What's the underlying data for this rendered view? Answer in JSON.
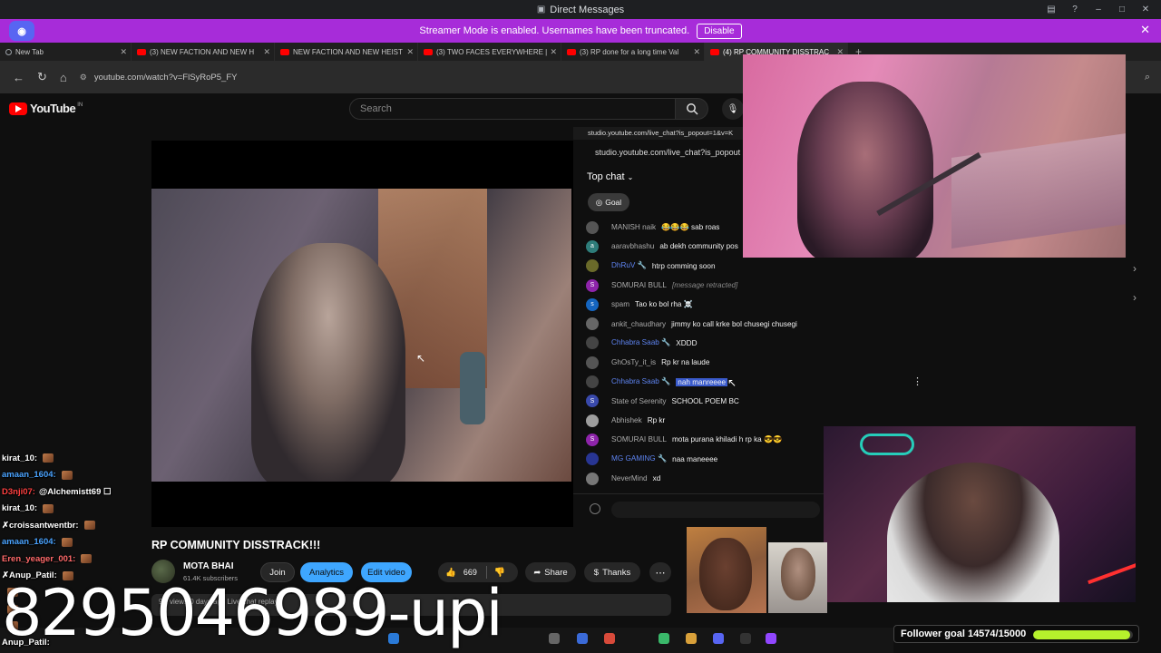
{
  "discord": {
    "window_title": "Direct Messages",
    "banner_text": "Streamer Mode is enabled. Usernames have been truncated.",
    "disable_label": "Disable"
  },
  "browser": {
    "tabs": [
      {
        "label": "New Tab"
      },
      {
        "label": "(3) NEW FACTION AND NEW H"
      },
      {
        "label": "NEW FACTION AND NEW HEIST"
      },
      {
        "label": "(3) TWO FACES EVERYWHERE |"
      },
      {
        "label": "(3) RP done for a long time Val"
      },
      {
        "label": "(4) RP COMMUNITY DISSTRAC"
      }
    ],
    "address": "youtube.com/watch?v=FlSyRoP5_FY"
  },
  "youtube": {
    "brand": "YouTube",
    "country": "IN",
    "search_placeholder": "Search",
    "video_title": "RP COMMUNITY DISSTRACK!!!",
    "channel_name": "MOTA BHAI",
    "subscribers": "61.4K subscribers",
    "join_label": "Join",
    "analytics_label": "Analytics",
    "edit_label": "Edit video",
    "like_count": "669",
    "share_label": "Share",
    "thanks_label": "Thanks",
    "desc_preview": "9K views  0 days ago  Live chat replay"
  },
  "live_chat": {
    "popout_url_small": "studio.youtube.com/live_chat?is_popout=1&v=K",
    "popout_url": "studio.youtube.com/live_chat?is_popout",
    "header": "Top chat",
    "goal_label": "Goal",
    "messages": [
      {
        "author": "MANISH naik",
        "text": "😂😂😂 sab roas",
        "mod": false,
        "avatar_color": "#555555",
        "avatar": ""
      },
      {
        "author": "aaravbhashu",
        "text": "ab dekh community pos",
        "mod": false,
        "avatar_color": "#2e7d7a",
        "avatar": "a"
      },
      {
        "author": "DhRuV 🔧",
        "text": "htrp comming soon",
        "mod": true,
        "avatar_color": "#6a6a2a",
        "avatar": ""
      },
      {
        "author": "SOMURAI BULL",
        "text": "[message retracted]",
        "mod": false,
        "retracted": true,
        "avatar_color": "#8e24aa",
        "avatar": "S"
      },
      {
        "author": "spam",
        "text": "Tao ko bol rha ☠️",
        "mod": false,
        "avatar_color": "#1565c0",
        "avatar": "s"
      },
      {
        "author": "ankit_chaudhary",
        "text": "jimmy ko call krke bol chusegi chusegi",
        "mod": false,
        "avatar_color": "#666666",
        "avatar": ""
      },
      {
        "author": "Chhabra Saab 🔧",
        "text": "XDDD",
        "mod": true,
        "avatar_color": "#444444",
        "avatar": ""
      },
      {
        "author": "GhOsTy_it_is",
        "text": "Rp kr na laude",
        "mod": false,
        "avatar_color": "#555555",
        "avatar": ""
      },
      {
        "author": "Chhabra Saab 🔧",
        "text": "nah manreeee",
        "mod": true,
        "highlight": true,
        "avatar_color": "#444444",
        "avatar": ""
      },
      {
        "author": "State of Serenity",
        "text": "SCHOOL POEM BC",
        "mod": false,
        "avatar_color": "#3949ab",
        "avatar": "S"
      },
      {
        "author": "Abhishek",
        "text": "Rp kr",
        "mod": false,
        "avatar_color": "#9e9e9e",
        "avatar": ""
      },
      {
        "author": "SOMURAI BULL",
        "text": "mota purana khiladi h rp ka 😎😎",
        "mod": false,
        "avatar_color": "#8e24aa",
        "avatar": "S"
      },
      {
        "author": "MG GAMING 🔧",
        "text": "naa maneeee",
        "mod": true,
        "avatar_color": "#283593",
        "avatar": ""
      },
      {
        "author": "NeverMind",
        "text": "xd",
        "mod": false,
        "avatar_color": "#777777",
        "avatar": ""
      }
    ]
  },
  "twitch_chat": [
    {
      "user": "kirat_10:",
      "color": "#ffffff",
      "msg": "",
      "emote": true
    },
    {
      "user": "amaan_1604:",
      "color": "#4aa3ff",
      "msg": "",
      "emote": true
    },
    {
      "user": "D3nji07:",
      "color": "#ff4040",
      "msg": "@Alchemistt69 ☐",
      "emote": false
    },
    {
      "user": "kirat_10:",
      "color": "#ffffff",
      "msg": "",
      "emote": true
    },
    {
      "user": "✗croissantwentbr:",
      "color": "#ffffff",
      "msg": "",
      "emote": true
    },
    {
      "user": "amaan_1604:",
      "color": "#4aa3ff",
      "msg": "",
      "emote": true
    },
    {
      "user": "Eren_yeager_001:",
      "color": "#ff6a6a",
      "msg": "",
      "emote": true
    },
    {
      "user": "✗Anup_Patil:",
      "color": "#ffffff",
      "msg": "",
      "emote": true
    },
    {
      "user": "",
      "color": "#ffffff",
      "msg": "",
      "emote": true
    },
    {
      "user": "",
      "color": "#7bd77b",
      "msg": "",
      "emote": true
    },
    {
      "user": "",
      "color": "#ff6a6a",
      "msg": "",
      "emote": true
    },
    {
      "user": "Anup_Patil:",
      "color": "#ffffff",
      "msg": "",
      "emote": false
    }
  ],
  "upi_text": "8295046989-upi",
  "follower_goal": {
    "label": "Follower goal 14574/15000",
    "current": 14574,
    "target": 15000,
    "fill_color": "#b6f12c"
  },
  "colors": {
    "discord_banner": "#a72cd9",
    "youtube_red": "#ff0000",
    "analytics_blue": "#3ea6ff",
    "mod_name_blue": "#5e84f1"
  }
}
